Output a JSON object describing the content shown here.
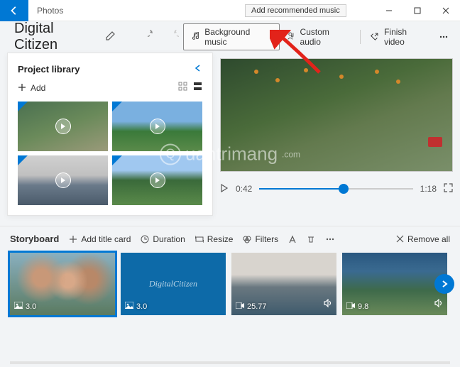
{
  "titlebar": {
    "app": "Photos"
  },
  "tooltip": "Add recommended music",
  "project": {
    "name": "Digital Citizen"
  },
  "toolbar": {
    "bg_music": "Background music",
    "custom_audio": "Custom audio",
    "finish": "Finish video"
  },
  "library": {
    "title": "Project library",
    "add": "Add"
  },
  "player": {
    "current": "0:42",
    "total": "1:18"
  },
  "storyboard": {
    "title": "Storyboard",
    "add_title": "Add title card",
    "duration": "Duration",
    "resize": "Resize",
    "filters": "Filters",
    "remove_all": "Remove all",
    "clips": [
      {
        "dur": "3.0"
      },
      {
        "dur": "3.0",
        "caption": "DigitalCitizen"
      },
      {
        "dur": "25.77"
      },
      {
        "dur": "9.8"
      }
    ]
  }
}
